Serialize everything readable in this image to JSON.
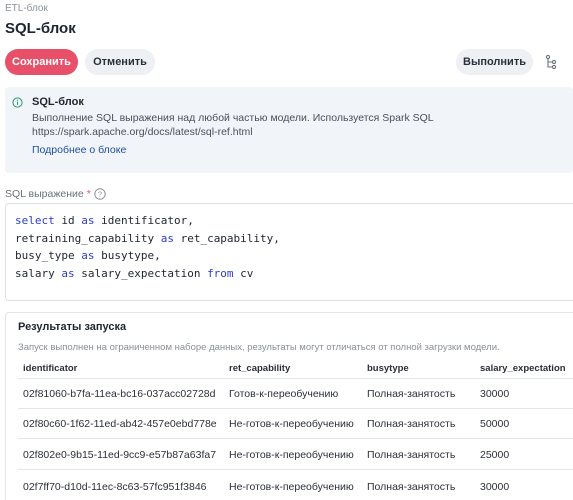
{
  "header": {
    "breadcrumb": "ETL-блок",
    "title": "SQL-блок"
  },
  "toolbar": {
    "save_label": "Сохранить",
    "cancel_label": "Отменить",
    "run_label": "Выполнить",
    "tree_icon": "tree-structure-icon"
  },
  "colors": {
    "primary": "#e8506a",
    "link": "#1e4fa3",
    "keyword": "#2b3ec9"
  },
  "info": {
    "icon": "info-icon",
    "title": "SQL-блок",
    "description_line1": "Выполнение SQL выражения над любой частью модели. Используется Spark SQL",
    "description_line2": "https://spark.apache.org/docs/latest/sql-ref.html",
    "link": "Подробнее о блоке"
  },
  "sql_field": {
    "label": "SQL выражение",
    "required_mark": "*",
    "help_icon": "question-circle-icon",
    "lines": [
      [
        {
          "t": "select",
          "kw": true
        },
        {
          "t": " id ",
          "kw": false
        },
        {
          "t": "as",
          "kw": true
        },
        {
          "t": " identificator,",
          "kw": false
        }
      ],
      [
        {
          "t": "retraining_capability ",
          "kw": false
        },
        {
          "t": "as",
          "kw": true
        },
        {
          "t": " ret_capability,",
          "kw": false
        }
      ],
      [
        {
          "t": "busy_type ",
          "kw": false
        },
        {
          "t": "as",
          "kw": true
        },
        {
          "t": " busytype,",
          "kw": false
        }
      ],
      [
        {
          "t": "salary ",
          "kw": false
        },
        {
          "t": "as",
          "kw": true
        },
        {
          "t": " salary_expectation ",
          "kw": false
        },
        {
          "t": "from",
          "kw": true
        },
        {
          "t": " cv",
          "kw": false
        }
      ]
    ]
  },
  "results": {
    "title": "Результаты запуска",
    "note": "Запуск выполнен на ограниченном наборе данных, результаты могут отличаться от полной загрузки модели.",
    "columns": [
      "identificator",
      "ret_capability",
      "busytype",
      "salary_expectation"
    ],
    "rows": [
      [
        "02f81060-b7fa-11ea-bc16-037acc02728d",
        "Готов-к-переобучению",
        "Полная-занятость",
        "30000"
      ],
      [
        "02f80c60-1f62-11ed-ab42-457e0ebd778e",
        "Не-готов-к-переобучению",
        "Полная-занятость",
        "50000"
      ],
      [
        "02f802e0-9b15-11ed-9cc9-e57b87a63fa7",
        "Не-готов-к-переобучению",
        "Полная-занятость",
        "25000"
      ],
      [
        "02f7ff70-d10d-11ec-8c63-57fc951f3846",
        "Не-готов-к-переобучению",
        "Полная-занятость",
        "30000"
      ]
    ]
  }
}
